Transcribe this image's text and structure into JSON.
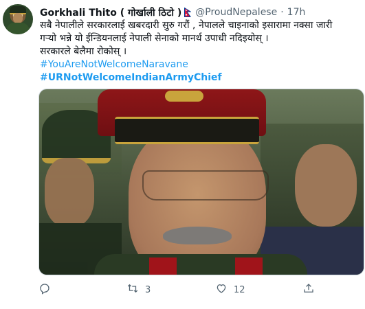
{
  "tweet": {
    "display_name": "Gorkhali Thito ( गोर्खाली ठिटो )",
    "handle": "@ProudNepalese",
    "separator": "·",
    "time": "17h",
    "text_lines": [
      "सबै नेपालीले सरकारलाई खबरदारी सुरु गरौं , नेपालले चाइनाको इसारामा नक्सा जारी",
      "गऱ्यो भन्ने यो ईन्डियनलाई नेपाली सेनाको मानर्थ उपाधी नदिइयोस् ।",
      "सरकारले बेलैमा रोकोस् ।"
    ],
    "hashtags": [
      "#YouAreNotWelcomeNaravane",
      "#URNotWelcomeIndianArmyChief"
    ]
  },
  "actions": {
    "reply_count": "",
    "retweet_count": "3",
    "like_count": "12"
  },
  "icons": {
    "avatar": "avatar",
    "flag": "nepal-flag-icon",
    "reply": "reply-icon",
    "retweet": "retweet-icon",
    "like": "heart-icon",
    "share": "share-icon"
  },
  "colors": {
    "hashtag": "#1d9bf0",
    "muted": "#536471",
    "text": "#0f1419",
    "flag_red": "#dc143c",
    "flag_blue": "#003893"
  }
}
